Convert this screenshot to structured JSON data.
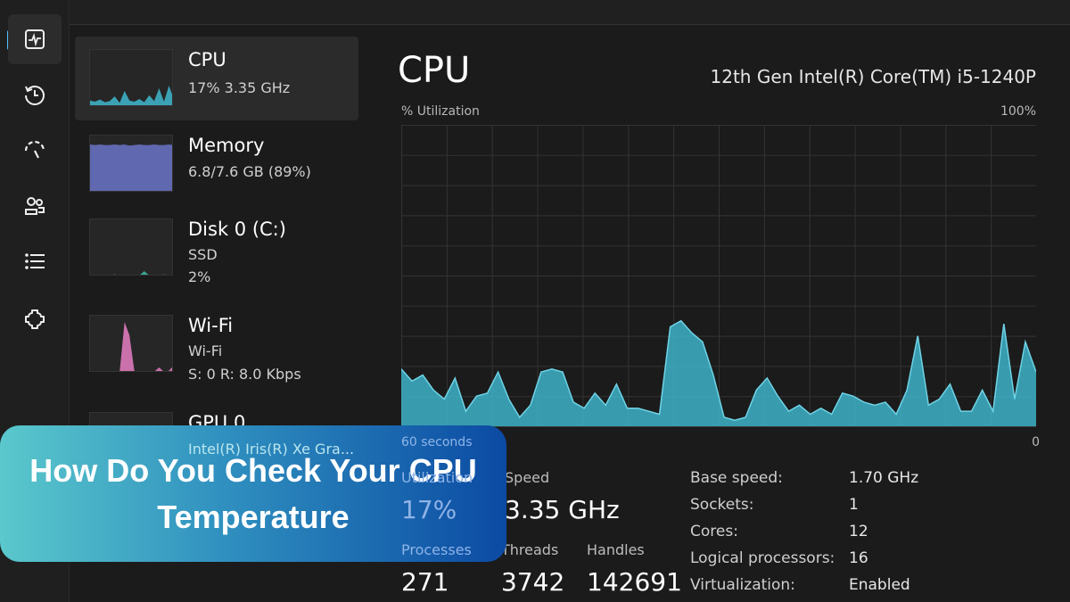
{
  "nav": {
    "items": [
      {
        "icon": "performance-icon",
        "active": true
      },
      {
        "icon": "app-history-icon"
      },
      {
        "icon": "startup-apps-icon"
      },
      {
        "icon": "users-icon"
      },
      {
        "icon": "details-list-icon"
      },
      {
        "icon": "services-icon"
      }
    ]
  },
  "resources": [
    {
      "name": "CPU",
      "line1": "17%  3.35 GHz",
      "color": "#3fb8cf",
      "values": [
        12,
        10,
        14,
        9,
        11,
        20,
        8,
        30,
        12,
        10,
        15,
        9,
        22,
        11,
        35,
        10,
        40,
        14
      ]
    },
    {
      "name": "Memory",
      "line1": "6.8/7.6 GB (89%)",
      "color": "#6b74c9",
      "values": [
        90,
        89,
        90,
        89,
        89,
        90,
        89,
        90,
        88,
        89,
        90,
        89,
        89,
        90,
        89,
        89,
        90,
        89
      ]
    },
    {
      "name": "Disk 0 (C:)",
      "line1": "SSD",
      "line2": "2%",
      "color": "#3fb8a8",
      "values": [
        2,
        2,
        3,
        2,
        2,
        4,
        2,
        3,
        2,
        3,
        2,
        10,
        2,
        3,
        2,
        4,
        2,
        3
      ]
    },
    {
      "name": "Wi-Fi",
      "line1": "Wi-Fi",
      "line2": "S: 0 R: 8.0 Kbps",
      "color": "#e87fc4",
      "values": [
        2,
        2,
        2,
        2,
        2,
        2,
        2,
        95,
        70,
        2,
        2,
        2,
        2,
        2,
        10,
        2,
        4,
        14
      ]
    },
    {
      "name": "GPU 0",
      "line1": "Intel(R) Iris(R) Xe Gra...",
      "color": "#3fb8cf",
      "values": []
    }
  ],
  "main": {
    "title": "CPU",
    "model": "12th Gen Intel(R) Core(TM) i5-1240P",
    "stats": {
      "utilization_label": "Utilization",
      "utilization": "17%",
      "speed_label": "Speed",
      "speed": "3.35 GHz",
      "processes_label": "Processes",
      "processes": "271",
      "threads_label": "Threads",
      "threads": "3742",
      "handles_label": "Handles",
      "handles": "142691"
    },
    "specs": [
      {
        "k": "Base speed:",
        "v": "1.70 GHz"
      },
      {
        "k": "Sockets:",
        "v": "1"
      },
      {
        "k": "Cores:",
        "v": "12"
      },
      {
        "k": "Logical processors:",
        "v": "16"
      },
      {
        "k": "Virtualization:",
        "v": "Enabled"
      }
    ]
  },
  "chart_data": {
    "type": "area",
    "ylabel": "% Utilization",
    "ymax_label": "100%",
    "xlabel_left": "60 seconds",
    "xlabel_right": "0",
    "ylim": [
      0,
      100
    ],
    "xlim": [
      60,
      0
    ],
    "grid": true,
    "color": "#3fb8cf",
    "values": [
      19,
      15,
      17,
      12,
      9,
      16,
      5,
      10,
      11,
      18,
      9,
      3,
      7,
      18,
      19,
      18,
      8,
      6,
      11,
      7,
      14,
      6,
      6,
      5,
      4,
      33,
      35,
      31,
      28,
      17,
      3,
      2,
      3,
      12,
      16,
      10,
      5,
      7,
      4,
      6,
      4,
      11,
      10,
      8,
      7,
      8,
      4,
      12,
      30,
      7,
      9,
      14,
      5,
      5,
      12,
      5,
      34,
      9,
      28,
      18
    ]
  },
  "banner": {
    "text": "How Do You Check Your CPU Temperature"
  }
}
